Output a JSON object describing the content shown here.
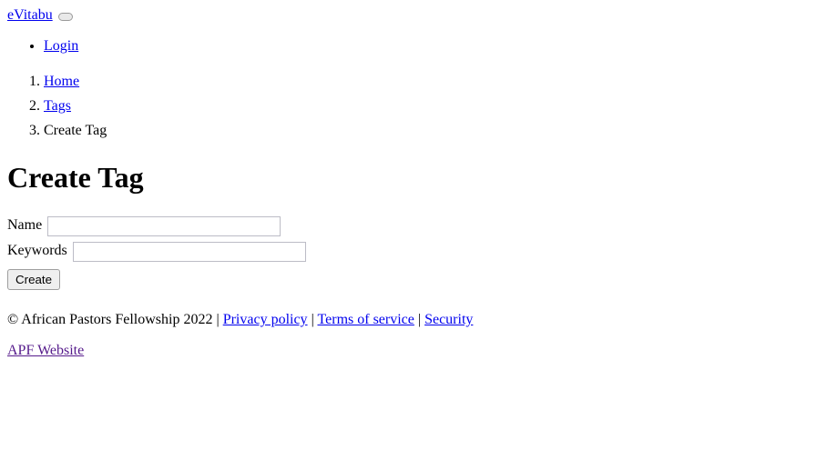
{
  "colors": {
    "link": "#0000EE",
    "visited_link": "#551A8B",
    "text": "#000000",
    "background": "#ffffff",
    "input_border": "#bcbcc6",
    "button_background": "#efefef",
    "button_border": "#9e9e9e"
  },
  "navbar": {
    "brand": "eVitabu",
    "toggler_label": "",
    "items": [
      {
        "label": "Login"
      }
    ]
  },
  "breadcrumb": {
    "items": [
      {
        "label": "Home",
        "is_link": true
      },
      {
        "label": "Tags",
        "is_link": true
      },
      {
        "label": "Create Tag",
        "is_link": false
      }
    ]
  },
  "main": {
    "title": "Create Tag",
    "form": {
      "name_label": "Name",
      "name_value": "",
      "name_placeholder": "",
      "keywords_label": "Keywords",
      "keywords_value": "",
      "keywords_placeholder": "",
      "submit_label": "Create"
    }
  },
  "footer": {
    "copyright": "© African Pastors Fellowship 2022",
    "separator": "|",
    "links": [
      {
        "label": "Privacy policy"
      },
      {
        "label": "Terms of service"
      },
      {
        "label": "Security"
      }
    ],
    "apf_link": "APF Website"
  }
}
